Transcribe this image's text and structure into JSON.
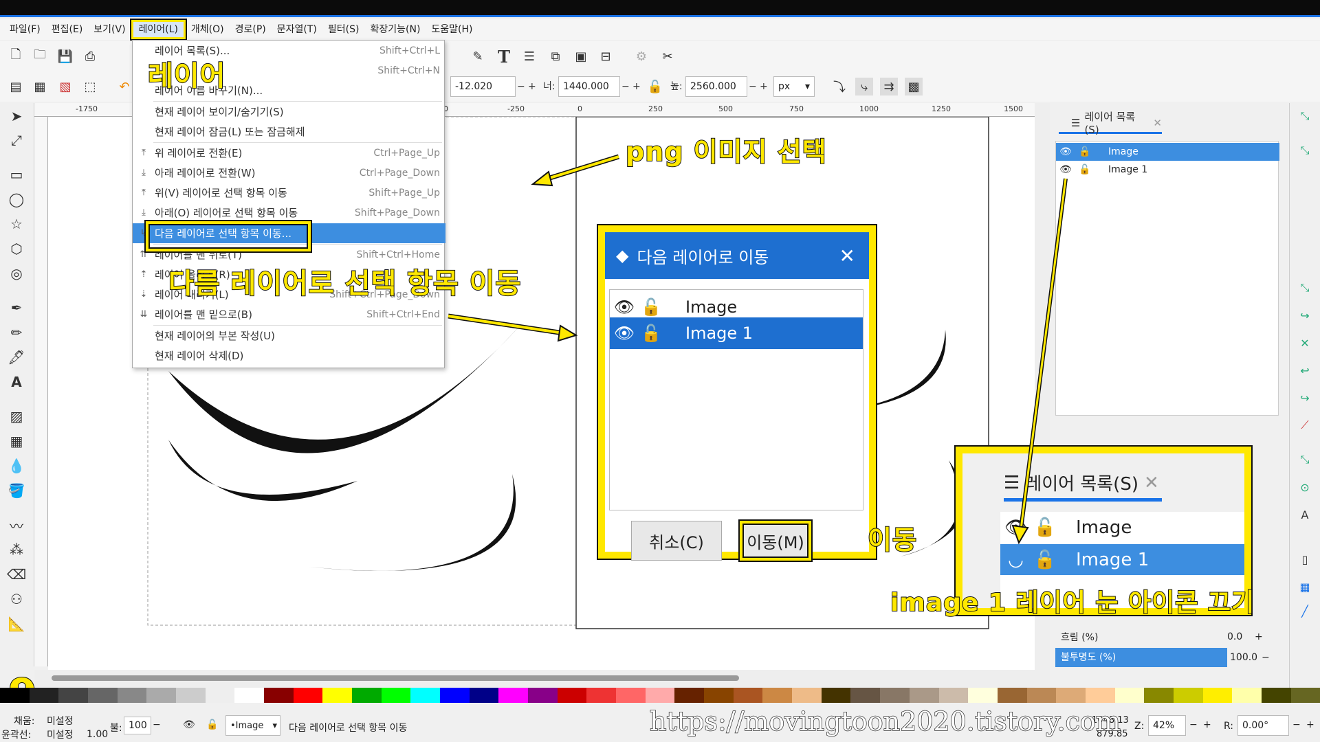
{
  "menubar": {
    "items": [
      "파일(F)",
      "편집(E)",
      "보기(V)",
      "레이어(L)",
      "개체(O)",
      "경로(P)",
      "문자열(T)",
      "필터(S)",
      "확장기능(N)",
      "도움말(H)"
    ]
  },
  "toolbar": {
    "x_value": "-12.020",
    "w_label": "너:",
    "w_value": "1440.000",
    "h_label": "높:",
    "h_value": "2560.000",
    "unit": "px"
  },
  "ruler": {
    "ticks": [
      "-1750",
      "0",
      "-250",
      "0",
      "250",
      "500",
      "750",
      "1000",
      "1250",
      "1500"
    ]
  },
  "layer_menu": {
    "items": [
      {
        "label": "레이어 목록(S)...",
        "shortcut": "Shift+Ctrl+L"
      },
      {
        "label": "",
        "shortcut": "Shift+Ctrl+N"
      },
      {
        "label": "레이어 이름 바꾸기(N)...",
        "shortcut": ""
      },
      {
        "label": "현재 레이어 보이기/숨기기(S)",
        "shortcut": ""
      },
      {
        "label": "현재 레이어 잠금(L) 또는 잠금해제",
        "shortcut": ""
      },
      {
        "label": "위 레이어로 전환(E)",
        "shortcut": "Ctrl+Page_Up"
      },
      {
        "label": "아래 레이어로 전환(W)",
        "shortcut": "Ctrl+Page_Down"
      },
      {
        "label": "위(V) 레이어로 선택 항목 이동",
        "shortcut": "Shift+Page_Up"
      },
      {
        "label": "아래(O) 레이어로 선택 항목 이동",
        "shortcut": "Shift+Page_Down"
      },
      {
        "label": "다음 레이어로 선택 항목 이동...",
        "shortcut": ""
      },
      {
        "label": "레이어를 맨 위로(T)",
        "shortcut": "Shift+Ctrl+Home"
      },
      {
        "label": "레이어 올리기(R)",
        "shortcut": ""
      },
      {
        "label": "레이어 내리기(L)",
        "shortcut": "Shift+Ctrl+Page_Down"
      },
      {
        "label": "레이어를 맨 밑으로(B)",
        "shortcut": "Shift+Ctrl+End"
      },
      {
        "label": "현재 레이어의 부본 작성(U)",
        "shortcut": ""
      },
      {
        "label": "현재 레이어 삭제(D)",
        "shortcut": ""
      }
    ]
  },
  "layers_panel": {
    "tab": "레이어 목록(S)",
    "layers": [
      "Image",
      "Image 1"
    ],
    "blur_label": "흐림 (%)",
    "blur_value": "0.0",
    "opacity_label": "불투명도 (%)",
    "opacity_value": "100.0"
  },
  "dialog": {
    "title": "다음 레이어로 이동",
    "layers": [
      "Image",
      "Image 1"
    ],
    "cancel": "취소(C)",
    "move": "이동(M)"
  },
  "annotations": {
    "layer": "레이어",
    "select_png": "png 이미지  선택",
    "move_to_next": "다름 레이어로 선택 항목 이동",
    "move": "이동",
    "eye_off": "image 1 레이어 눈 아이콘 끄기",
    "step": "9"
  },
  "statusbar": {
    "fill_label": "채움:",
    "fill_value": "미설정",
    "stroke_label": "윤곽선:",
    "stroke_value": "미설정",
    "stroke_width": "1.00",
    "opacity_label": "불:",
    "opacity_value": "100",
    "layer": "•Image",
    "message": "다음 레이어로 선택 항목 이동",
    "x_coord": "1048.13",
    "y_coord": "879.85",
    "zoom_label": "Z:",
    "zoom": "42%",
    "rot_label": "R:",
    "rotation": "0.00°",
    "watermark": "https://movingtoon2020.tistory.com"
  },
  "colors": {
    "accent": "#3d8ee0",
    "highlight": "#ffe800"
  }
}
